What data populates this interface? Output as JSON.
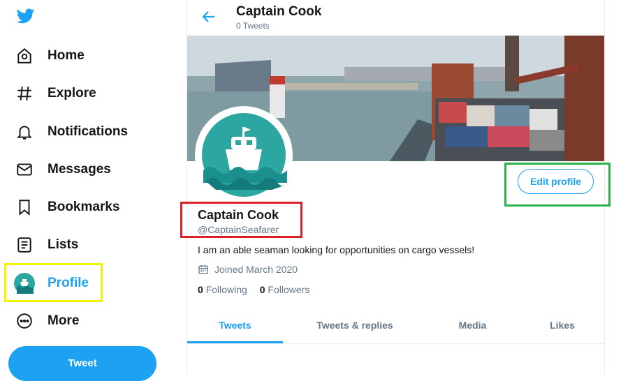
{
  "nav": {
    "items": [
      {
        "label": "Home",
        "icon": "home-icon"
      },
      {
        "label": "Explore",
        "icon": "hashtag-icon"
      },
      {
        "label": "Notifications",
        "icon": "bell-icon"
      },
      {
        "label": "Messages",
        "icon": "envelope-icon"
      },
      {
        "label": "Bookmarks",
        "icon": "bookmark-icon"
      },
      {
        "label": "Lists",
        "icon": "list-icon"
      },
      {
        "label": "Profile",
        "icon": "avatar"
      },
      {
        "label": "More",
        "icon": "more-icon"
      }
    ],
    "tweet_label": "Tweet"
  },
  "header": {
    "title": "Captain Cook",
    "subtitle": "0 Tweets"
  },
  "profile": {
    "name": "Captain Cook",
    "handle": "@CaptainSeafarer",
    "bio": "I am an able seaman looking for opportunities on cargo vessels!",
    "joined": "Joined March 2020",
    "following_count": "0",
    "following_label": "Following",
    "followers_count": "0",
    "followers_label": "Followers",
    "edit_label": "Edit profile"
  },
  "tabs": [
    {
      "label": "Tweets"
    },
    {
      "label": "Tweets & replies"
    },
    {
      "label": "Media"
    },
    {
      "label": "Likes"
    }
  ],
  "colors": {
    "accent": "#1da1f2",
    "highlight_yellow": "#f2f201",
    "highlight_red": "#d9202a",
    "highlight_green": "#2cb24b"
  }
}
